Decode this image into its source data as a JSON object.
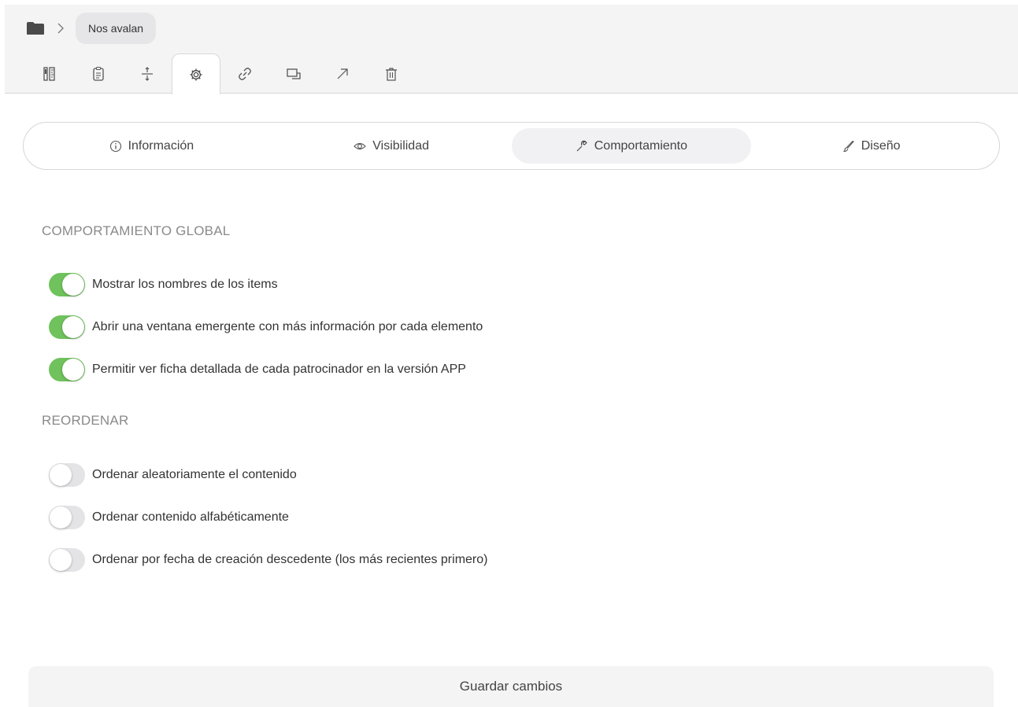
{
  "breadcrumb": {
    "folder_icon": "folder-icon",
    "separator_icon": "chevron-right-icon",
    "current": "Nos avalan"
  },
  "toolbar": {
    "tools": [
      {
        "icon": "ruler-icon"
      },
      {
        "icon": "clipboard-list-icon"
      },
      {
        "icon": "spacing-icon"
      },
      {
        "icon": "gear-icon",
        "active": true
      },
      {
        "icon": "link-icon"
      },
      {
        "icon": "window-icon"
      },
      {
        "icon": "arrow-up-right-icon"
      },
      {
        "icon": "trash-icon"
      }
    ]
  },
  "tabs": [
    {
      "label": "Información",
      "icon": "info-icon"
    },
    {
      "label": "Visibilidad",
      "icon": "eye-icon"
    },
    {
      "label": "Comportamiento",
      "icon": "wrench-icon",
      "active": true
    },
    {
      "label": "Diseño",
      "icon": "brush-icon"
    }
  ],
  "sections": {
    "global": {
      "title": "COMPORTAMIENTO GLOBAL",
      "options": [
        {
          "label": "Mostrar los nombres de los items",
          "enabled": true
        },
        {
          "label": "Abrir una ventana emergente con más información por cada elemento",
          "enabled": true
        },
        {
          "label": "Permitir ver ficha detallada de cada patrocinador en la versión APP",
          "enabled": true
        }
      ]
    },
    "reorder": {
      "title": "REORDENAR",
      "options": [
        {
          "label": "Ordenar aleatoriamente el contenido",
          "enabled": false
        },
        {
          "label": "Ordenar contenido alfabéticamente",
          "enabled": false
        },
        {
          "label": "Ordenar por fecha de creación descedente (los más recientes primero)",
          "enabled": false
        }
      ]
    }
  },
  "save_label": "Guardar cambios",
  "colors": {
    "toggle_on": "#6fc25c",
    "toggle_off": "#e4e4e6"
  }
}
